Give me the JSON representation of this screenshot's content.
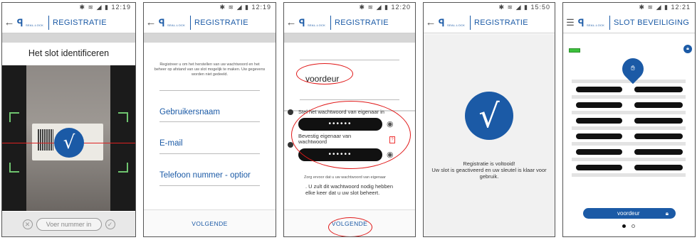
{
  "common": {
    "back_icon": "←",
    "menu_icon": "☰",
    "logo_brand": "SEAL-LOCK",
    "status_icons": "✱ ≋ ◢ ▮"
  },
  "screens": [
    {
      "status_time": "12:19",
      "title": "REGISTRATIE",
      "heading": "Het slot identificeren",
      "input_placeholder": "Voer nummer in",
      "cancel_icon": "✕",
      "confirm_icon": "✓"
    },
    {
      "status_time": "12:19",
      "title": "REGISTRATIE",
      "intro": "Registreer u om het herstellen van uw wachtwoord en het beheer op afstand van uw slot mogelijk te maken. Uw gegevens worden niet gedeeld.",
      "fields": [
        {
          "placeholder": "Gebruikersnaam"
        },
        {
          "placeholder": "E-mail"
        },
        {
          "placeholder": "Telefoon nummer - optior"
        }
      ],
      "next_label": "VOLGENDE"
    },
    {
      "status_time": "12:20",
      "title": "REGISTRATIE",
      "lock_name": "voordeur",
      "owner_password_label": "Stel het wachtwoord van eigenaar in",
      "owner_password_value": "••••••",
      "confirm_password_label": "Bevestig eigenaar van wachtwoord",
      "confirm_password_value": "••••••",
      "qmark": "?",
      "hint": "Zorg ervoor dat u uw wachtwoord van eigenaar",
      "warning": ". U zult dit wachtwoord nodig hebben elke keer dat u uw slot beheert.",
      "next_label": "VOLGENDE"
    },
    {
      "status_time": "15:50",
      "title": "REGISTRATIE",
      "check_glyph": "√",
      "done_line1": "Registratie is voltooid!",
      "done_line2": "Uw slot is geactiveerd en uw sleutel is klaar voor gebruik."
    },
    {
      "status_time": "12:21",
      "title": "SLOT BEVEILIGING",
      "lock_name": "voordeur",
      "battery_level": 1.0,
      "page_index": 0,
      "page_count": 2
    }
  ],
  "colors": {
    "brand": "#1b5aa6",
    "annotation_red": "#e01818",
    "battery_green": "#3cc13c"
  }
}
